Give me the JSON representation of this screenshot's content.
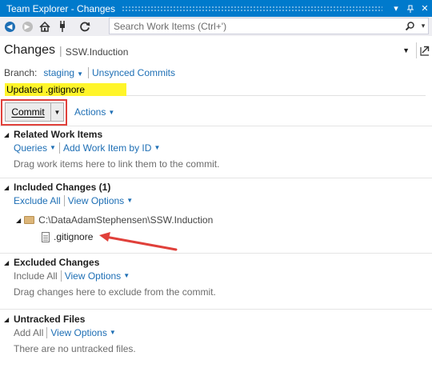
{
  "window": {
    "title": "Team Explorer - Changes"
  },
  "search": {
    "placeholder": "Search Work Items (Ctrl+')"
  },
  "header": {
    "title": "Changes",
    "project": "SSW.Induction"
  },
  "branch": {
    "label": "Branch:",
    "name": "staging",
    "unsynced_link": "Unsynced Commits"
  },
  "commit": {
    "message": "Updated .gitignore",
    "button_label": "Commit",
    "actions_label": "Actions"
  },
  "related_work_items": {
    "title": "Related Work Items",
    "queries_link": "Queries",
    "add_link": "Add Work Item by ID",
    "hint": "Drag work items here to link them to the commit."
  },
  "included_changes": {
    "title": "Included Changes (1)",
    "exclude_all": "Exclude All",
    "view_options": "View Options",
    "folder_path": "C:\\DataAdamStephensen\\SSW.Induction",
    "file_name": ".gitignore"
  },
  "excluded_changes": {
    "title": "Excluded Changes",
    "include_all": "Include All",
    "view_options": "View Options",
    "hint": "Drag changes here to exclude from the commit."
  },
  "untracked_files": {
    "title": "Untracked Files",
    "add_all": "Add All",
    "view_options": "View Options",
    "hint": "There are no untracked files."
  },
  "colors": {
    "title_bar": "#007acc",
    "link": "#1e6fb5",
    "highlight": "#fff52a",
    "annotation": "#e0403a"
  },
  "icons": [
    "back-icon",
    "forward-icon",
    "home-icon",
    "connect-icon",
    "refresh-icon",
    "search-icon",
    "dropdown-icon",
    "popout-icon",
    "folder-icon",
    "file-icon"
  ]
}
